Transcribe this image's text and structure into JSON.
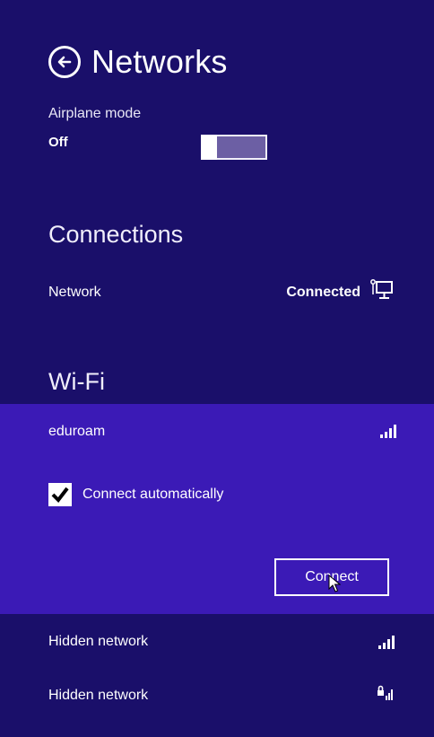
{
  "header": {
    "title": "Networks",
    "back_icon": "back-arrow-circle-icon"
  },
  "airplane": {
    "label": "Airplane mode",
    "state": "Off",
    "toggle_on": false
  },
  "connections": {
    "title": "Connections",
    "items": [
      {
        "name": "Network",
        "status": "Connected",
        "icon": "wired-network-icon"
      }
    ]
  },
  "wifi": {
    "title": "Wi-Fi",
    "selected": {
      "name": "eduroam",
      "signal_icon": "wifi-signal-icon",
      "connect_auto_label": "Connect automatically",
      "connect_auto_checked": true,
      "connect_button": "Connect"
    },
    "others": [
      {
        "name": "Hidden network",
        "icon": "wifi-signal-icon"
      },
      {
        "name": "Hidden network",
        "icon": "wifi-secured-signal-icon"
      }
    ]
  },
  "colors": {
    "background": "#1a0f6a",
    "selected": "#3b1ab6",
    "text": "#ffffff"
  }
}
